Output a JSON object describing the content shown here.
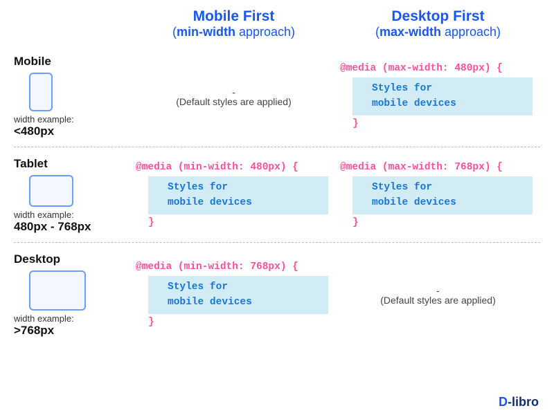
{
  "headers": {
    "mobileFirst": {
      "title": "Mobile First",
      "sub_prefix": "(",
      "sub_bold": "min-width",
      "sub_suffix": " approach)"
    },
    "desktopFirst": {
      "title": "Desktop First",
      "sub_prefix": "(",
      "sub_bold": "max-width",
      "sub_suffix": " approach)"
    }
  },
  "rows": {
    "mobile": {
      "label": "Mobile",
      "widthLabel": "width example:",
      "widthValue": "<480px",
      "colA_default_dash": "-",
      "colA_default_text": "(Default styles are applied)",
      "colB_media": "@media (max-width: 480px) {",
      "colB_styles_l1": "Styles for",
      "colB_styles_l2": "mobile devices",
      "colB_close": "}"
    },
    "tablet": {
      "label": "Tablet",
      "widthLabel": "width example:",
      "widthValue": "480px - 768px",
      "colA_media": "@media (min-width: 480px) {",
      "colA_styles_l1": "Styles for",
      "colA_styles_l2": "mobile devices",
      "colA_close": "}",
      "colB_media": "@media (max-width: 768px) {",
      "colB_styles_l1": "Styles for",
      "colB_styles_l2": "mobile devices",
      "colB_close": "}"
    },
    "desktop": {
      "label": "Desktop",
      "widthLabel": "width example:",
      "widthValue": ">768px",
      "colA_media": "@media (min-width: 768px) {",
      "colA_styles_l1": "Styles for",
      "colA_styles_l2": "mobile devices",
      "colA_close": "}",
      "colB_default_dash": "-",
      "colB_default_text": "(Default styles are applied)"
    }
  },
  "logo": {
    "d": "D",
    "rest": "-libro"
  }
}
